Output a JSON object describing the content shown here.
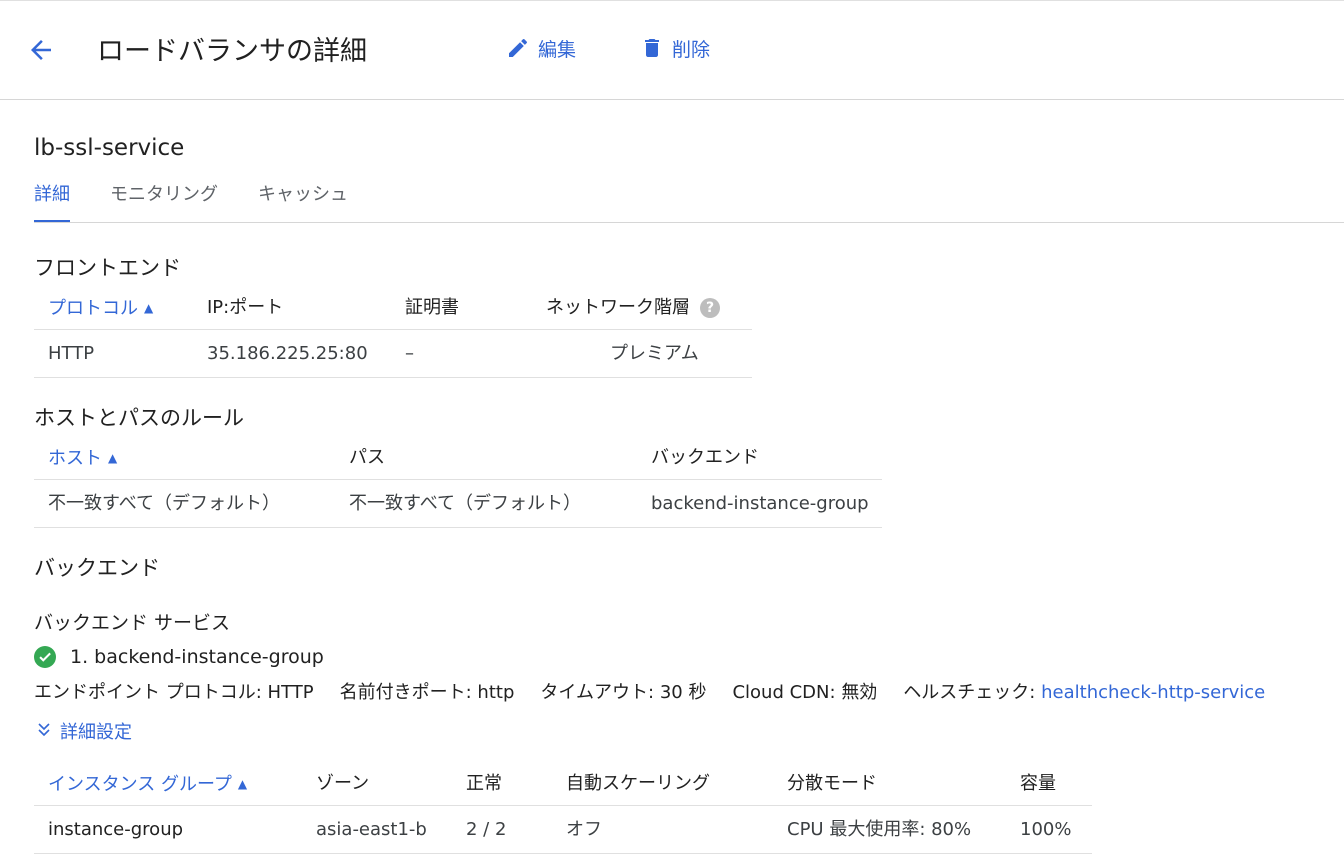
{
  "header": {
    "title": "ロードバランサの詳細",
    "edit_label": "編集",
    "delete_label": "削除"
  },
  "lb_name": "lb-ssl-service",
  "tabs": [
    {
      "label": "詳細",
      "active": true
    },
    {
      "label": "モニタリング",
      "active": false
    },
    {
      "label": "キャッシュ",
      "active": false
    }
  ],
  "frontend": {
    "heading": "フロントエンド",
    "columns": [
      "プロトコル",
      "IP:ポート",
      "証明書",
      "ネットワーク階層"
    ],
    "rows": [
      [
        "HTTP",
        "35.186.225.25:80",
        "–",
        "プレミアム"
      ]
    ]
  },
  "host_path_rules": {
    "heading": "ホストとパスのルール",
    "columns": [
      "ホスト",
      "パス",
      "バックエンド"
    ],
    "rows": [
      [
        "不一致すべて（デフォルト）",
        "不一致すべて（デフォルト）",
        "backend-instance-group"
      ]
    ]
  },
  "backend": {
    "heading": "バックエンド",
    "services_heading": "バックエンド サービス",
    "service_name": "1. backend-instance-group",
    "props": {
      "endpoint_protocol_label": "エンドポイント プロトコル:",
      "endpoint_protocol_value": "HTTP",
      "named_port_label": "名前付きポート:",
      "named_port_value": "http",
      "timeout_label": "タイムアウト:",
      "timeout_value": "30 秒",
      "cdn_label": "Cloud CDN:",
      "cdn_value": "無効",
      "health_label": "ヘルスチェック:",
      "health_value": "healthcheck-http-service"
    },
    "advanced_label": "詳細設定",
    "table": {
      "columns": [
        "インスタンス グループ",
        "ゾーン",
        "正常",
        "自動スケーリング",
        "分散モード",
        "容量"
      ],
      "rows": [
        [
          "instance-group",
          "asia-east1-b",
          "2 / 2",
          "オフ",
          "CPU 最大使用率: 80%",
          "100%"
        ]
      ]
    }
  },
  "colors": {
    "accent": "#3367d6",
    "success": "#34a853",
    "text": "#212121",
    "divider": "#e0e0e0"
  }
}
